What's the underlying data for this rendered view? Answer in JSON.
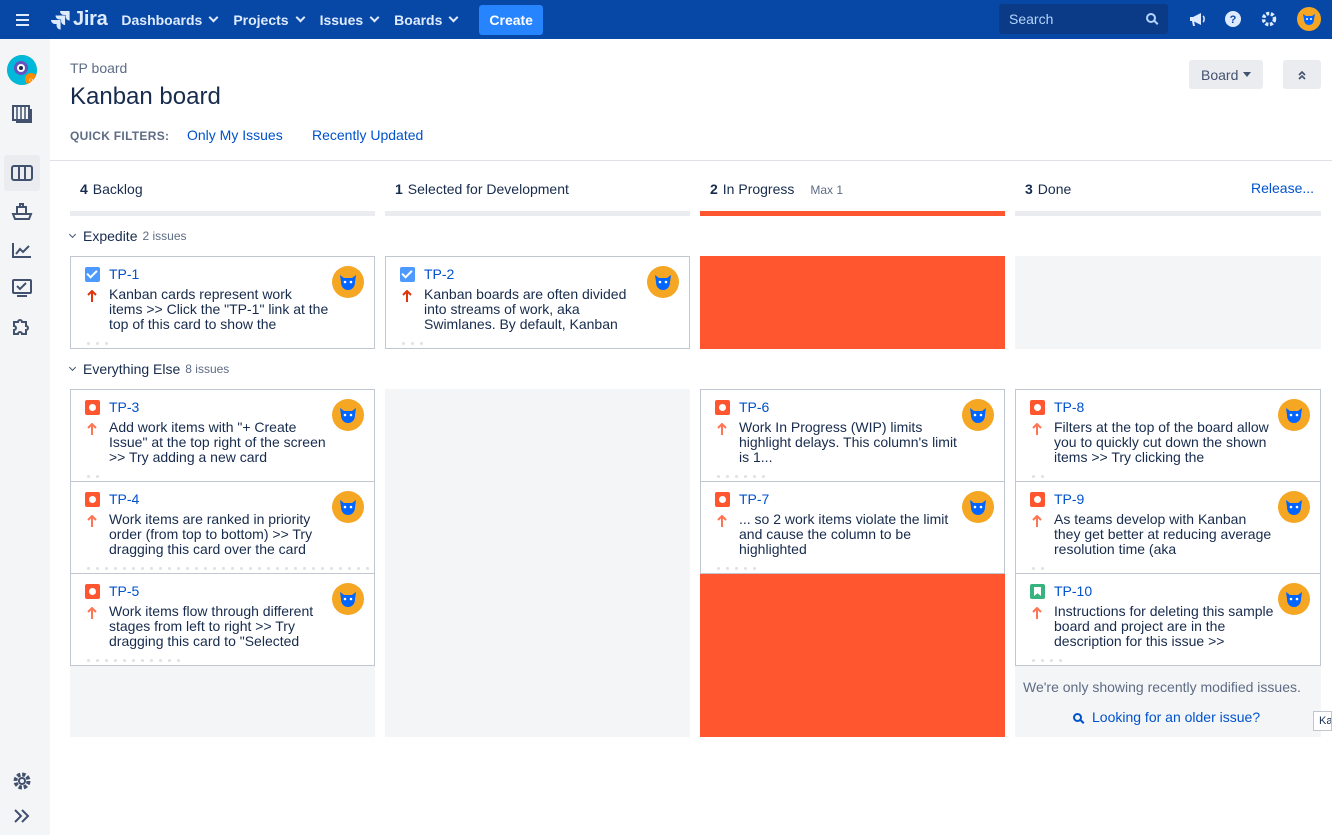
{
  "topnav": {
    "logo_text": "Jira",
    "items": [
      "Dashboards",
      "Projects",
      "Issues",
      "Boards"
    ],
    "create_label": "Create",
    "search_placeholder": "Search"
  },
  "header": {
    "breadcrumb": "TP board",
    "title": "Kanban board",
    "quick_filters_label": "QUICK FILTERS:",
    "quick_filters": [
      "Only My Issues",
      "Recently Updated"
    ],
    "board_button": "Board"
  },
  "columns": [
    {
      "count": "4",
      "name": "Backlog",
      "max": ""
    },
    {
      "count": "1",
      "name": "Selected for Development",
      "max": ""
    },
    {
      "count": "2",
      "name": "In Progress",
      "max": "Max 1"
    },
    {
      "count": "3",
      "name": "Done",
      "max": ""
    }
  ],
  "release_label": "Release...",
  "swimlanes": [
    {
      "name": "Expedite",
      "count": "2 issues"
    },
    {
      "name": "Everything Else",
      "count": "8 issues"
    }
  ],
  "cards": {
    "tp1": {
      "key": "TP-1",
      "summary": "Kanban cards represent work items >> Click the \"TP-1\" link at the top of this card to show the",
      "type": "task",
      "priority": "highest"
    },
    "tp2": {
      "key": "TP-2",
      "summary": "Kanban boards are often divided into streams of work, aka Swimlanes. By default, Kanban",
      "type": "task",
      "priority": "highest"
    },
    "tp3": {
      "key": "TP-3",
      "summary": "Add work items with \"+ Create Issue\" at the top right of the screen >> Try adding a new card",
      "type": "bug",
      "priority": "high"
    },
    "tp4": {
      "key": "TP-4",
      "summary": "Work items are ranked in priority order (from top to bottom) >> Try dragging this card over the card",
      "type": "bug",
      "priority": "high"
    },
    "tp5": {
      "key": "TP-5",
      "summary": "Work items flow through different stages from left to right >> Try dragging this card to \"Selected",
      "type": "bug",
      "priority": "high"
    },
    "tp6": {
      "key": "TP-6",
      "summary": "Work In Progress (WIP) limits highlight delays. This column's limit is 1...",
      "type": "bug",
      "priority": "high"
    },
    "tp7": {
      "key": "TP-7",
      "summary": "... so 2 work items violate the limit and cause the column to be highlighted",
      "type": "bug",
      "priority": "high"
    },
    "tp8": {
      "key": "TP-8",
      "summary": "Filters at the top of the board allow you to quickly cut down the shown items >> Try clicking the",
      "type": "bug",
      "priority": "high"
    },
    "tp9": {
      "key": "TP-9",
      "summary": "As teams develop with Kanban they get better at reducing average resolution time (aka",
      "type": "bug",
      "priority": "high"
    },
    "tp10": {
      "key": "TP-10",
      "summary": "Instructions for deleting this sample board and project are in the description for this issue >>",
      "type": "story",
      "priority": "high"
    }
  },
  "done_footer": {
    "info": "We're only showing recently modified issues.",
    "link": "Looking for an older issue?"
  },
  "tooltip": "Ka",
  "colors": {
    "nav": "#0747a6",
    "accent": "#0052cc",
    "wip_exceeded": "#ff5630",
    "priority_highest": "#de350b",
    "priority_high": "#ff7452"
  }
}
